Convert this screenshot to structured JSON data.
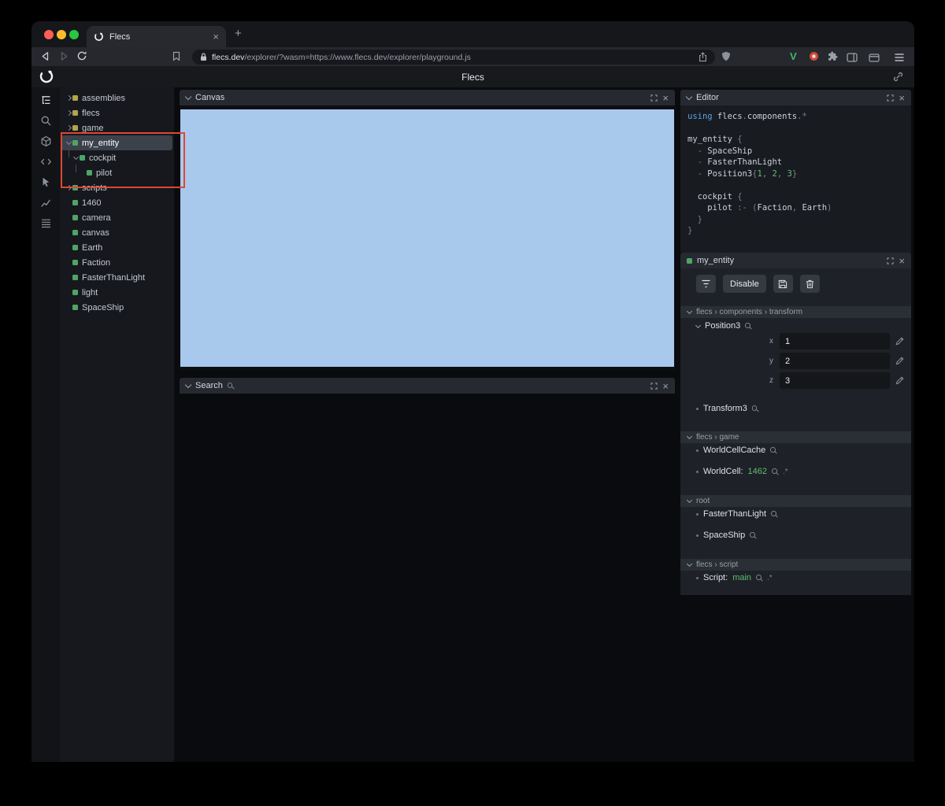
{
  "colors": {
    "entity_green": "#4da568",
    "module_yellow": "#b5a44a",
    "canvas_blue": "#a9c9ec",
    "annotation_red": "#e04634",
    "code_keyword": "#5ca2e6",
    "code_number": "#66bf79",
    "value_green": "#5fbe70"
  },
  "browser": {
    "tab_title": "Flecs",
    "url_domain": "flecs.dev",
    "url_path": "/explorer/?wasm=https://www.flecs.dev/explorer/playground.js"
  },
  "app": {
    "title": "Flecs"
  },
  "tree": {
    "items": [
      {
        "label": "assemblies"
      },
      {
        "label": "flecs"
      },
      {
        "label": "game"
      },
      {
        "label": "my_entity"
      },
      {
        "label": "cockpit"
      },
      {
        "label": "pilot"
      },
      {
        "label": "scripts"
      },
      {
        "label": "1460"
      },
      {
        "label": "camera"
      },
      {
        "label": "canvas"
      },
      {
        "label": "Earth"
      },
      {
        "label": "Faction"
      },
      {
        "label": "FasterThanLight"
      },
      {
        "label": "light"
      },
      {
        "label": "SpaceShip"
      }
    ]
  },
  "panels": {
    "canvas": {
      "title": "Canvas"
    },
    "search": {
      "title": "Search"
    },
    "editor": {
      "title": "Editor"
    },
    "inspector": {
      "title": "my_entity"
    }
  },
  "editor": {
    "lines": [
      [
        {
          "c": "k",
          "t": "using"
        },
        {
          "c": "i",
          "t": " flecs"
        },
        {
          "c": "p",
          "t": "."
        },
        {
          "c": "i",
          "t": "components"
        },
        {
          "c": "p",
          "t": ".*"
        }
      ],
      [],
      [
        {
          "c": "i",
          "t": "my_entity "
        },
        {
          "c": "p",
          "t": "{"
        }
      ],
      [
        {
          "c": "p",
          "t": "  - "
        },
        {
          "c": "i",
          "t": "SpaceShip"
        }
      ],
      [
        {
          "c": "p",
          "t": "  - "
        },
        {
          "c": "i",
          "t": "FasterThanLight"
        }
      ],
      [
        {
          "c": "p",
          "t": "  - "
        },
        {
          "c": "i",
          "t": "Position3"
        },
        {
          "c": "p",
          "t": "{"
        },
        {
          "c": "n",
          "t": "1"
        },
        {
          "c": "p",
          "t": ", "
        },
        {
          "c": "n",
          "t": "2"
        },
        {
          "c": "p",
          "t": ", "
        },
        {
          "c": "n",
          "t": "3"
        },
        {
          "c": "p",
          "t": "}"
        }
      ],
      [],
      [
        {
          "c": "i",
          "t": "  cockpit "
        },
        {
          "c": "p",
          "t": "{"
        }
      ],
      [
        {
          "c": "i",
          "t": "    pilot "
        },
        {
          "c": "p",
          "t": ":- ("
        },
        {
          "c": "i",
          "t": "Faction"
        },
        {
          "c": "p",
          "t": ", "
        },
        {
          "c": "i",
          "t": "Earth"
        },
        {
          "c": "p",
          "t": ")"
        }
      ],
      [
        {
          "c": "p",
          "t": "  }"
        }
      ],
      [
        {
          "c": "p",
          "t": "}"
        }
      ]
    ]
  },
  "inspector": {
    "disable_label": "Disable",
    "sections": [
      {
        "path": "flecs › components › transform"
      },
      {
        "path": "flecs › game"
      },
      {
        "path": "root"
      },
      {
        "path": "flecs › script"
      }
    ],
    "position3": {
      "name": "Position3",
      "fields": [
        {
          "label": "x",
          "value": "1"
        },
        {
          "label": "y",
          "value": "2"
        },
        {
          "label": "z",
          "value": "3"
        }
      ]
    },
    "transform3": {
      "name": "Transform3"
    },
    "worldcellcache": {
      "name": "WorldCellCache"
    },
    "worldcell": {
      "name": "WorldCell:",
      "value": "1462",
      "suffix": ".*"
    },
    "fasterthanlight": {
      "name": "FasterThanLight"
    },
    "spaceship": {
      "name": "SpaceShip"
    },
    "script": {
      "name": "Script:",
      "value": "main",
      "suffix": ".*"
    }
  }
}
